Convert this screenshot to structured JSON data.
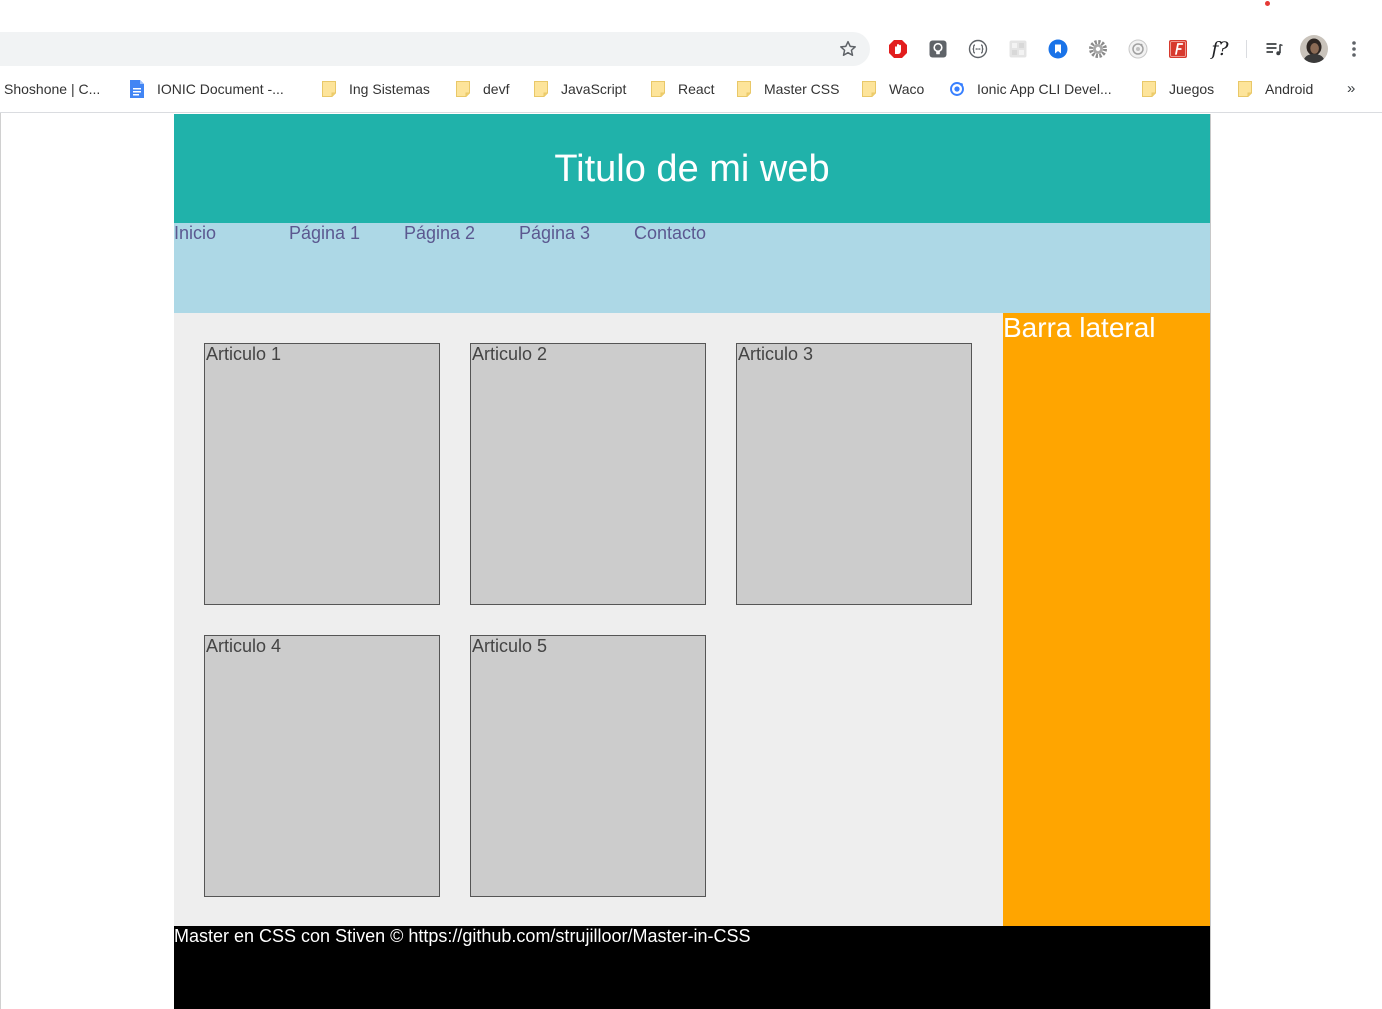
{
  "browser": {
    "omnibox": {
      "value": ""
    },
    "toolbar": {
      "bookmark_star_icon": "star-icon",
      "extensions": [
        {
          "icon": "block-site-icon"
        },
        {
          "icon": "lightbulb-icon"
        },
        {
          "icon": "code-braces-icon"
        },
        {
          "icon": "pixel-grid-icon"
        },
        {
          "icon": "bookmark-icon"
        },
        {
          "icon": "gear-icon"
        },
        {
          "icon": "camera-lens-icon"
        },
        {
          "icon": "red-f-icon"
        },
        {
          "icon": "whatfont-icon",
          "label": "f?"
        }
      ],
      "media_icon": "media-queue-icon",
      "profile_icon": "profile-avatar",
      "menu_icon": "kebab-menu-icon"
    },
    "bookmarks": [
      {
        "label": "Shoshone | C...",
        "icon": "none"
      },
      {
        "label": "IONIC Document -...",
        "icon": "google-docs-icon"
      },
      {
        "label": "Ing Sistemas",
        "icon": "folder-icon"
      },
      {
        "label": "devf",
        "icon": "folder-icon"
      },
      {
        "label": "JavaScript",
        "icon": "folder-icon"
      },
      {
        "label": "React",
        "icon": "folder-icon"
      },
      {
        "label": "Master CSS",
        "icon": "folder-icon"
      },
      {
        "label": "Waco",
        "icon": "folder-icon"
      },
      {
        "label": "Ionic App CLI Devel...",
        "icon": "ionic-icon"
      },
      {
        "label": "Juegos",
        "icon": "folder-icon"
      },
      {
        "label": "Android",
        "icon": "folder-icon"
      }
    ],
    "bookmarks_overflow": "»"
  },
  "page": {
    "header": {
      "title": "Titulo de mi web"
    },
    "nav": [
      {
        "label": "Inicio"
      },
      {
        "label": "Página 1"
      },
      {
        "label": "Página 2"
      },
      {
        "label": "Página 3"
      },
      {
        "label": "Contacto"
      }
    ],
    "articles": [
      {
        "title": "Articulo 1"
      },
      {
        "title": "Articulo 2"
      },
      {
        "title": "Articulo 3"
      },
      {
        "title": "Articulo 4"
      },
      {
        "title": "Articulo 5"
      }
    ],
    "sidebar": {
      "title": "Barra lateral"
    },
    "footer": {
      "text": "Master en CSS con Stiven © https://github.com/strujilloor/Master-in-CSS"
    }
  },
  "colors": {
    "header_bg": "#20B2AA",
    "header_text": "#FFFFFF",
    "nav_bg": "#ADD8E6",
    "nav_link": "#5B5890",
    "main_bg": "#EEEEEE",
    "article_bg": "#CCCCCC",
    "article_border": "#555555",
    "article_text": "#444444",
    "sidebar_bg": "#FFA500",
    "sidebar_text": "#FFFFFF",
    "footer_bg": "#000000",
    "footer_text": "#FFFFFF"
  }
}
